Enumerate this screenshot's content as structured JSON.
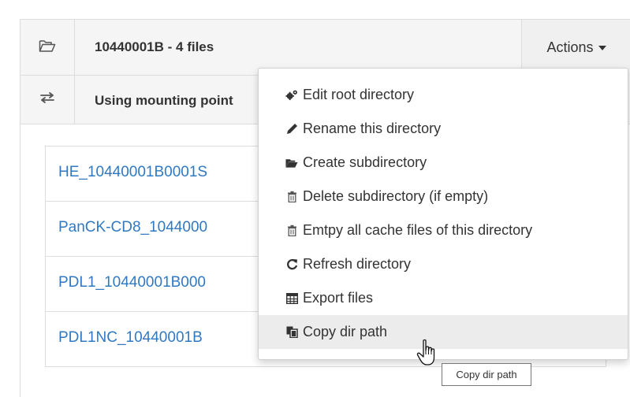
{
  "header": {
    "folder_title": "10440001B - 4 files",
    "mount_text": "Using mounting point",
    "actions_label": "Actions",
    "folder_icon": "folder-open-icon",
    "mount_icon": "exchange-icon"
  },
  "files": [
    {
      "name": "HE_10440001B0001S"
    },
    {
      "name": "PanCK-CD8_1044000"
    },
    {
      "name": "PDL1_10440001B000"
    },
    {
      "name": "PDL1NC_10440001B"
    }
  ],
  "menu": {
    "items": [
      {
        "label": "Edit root directory",
        "icon": "cogs-icon"
      },
      {
        "label": "Rename this directory",
        "icon": "pencil-icon"
      },
      {
        "label": "Create subdirectory",
        "icon": "folder-open-icon"
      },
      {
        "label": "Delete subdirectory (if empty)",
        "icon": "trash-icon"
      },
      {
        "label": "Emtpy all cache files of this directory",
        "icon": "trash-icon"
      },
      {
        "label": "Refresh directory",
        "icon": "refresh-icon"
      },
      {
        "label": "Export files",
        "icon": "table-icon"
      },
      {
        "label": "Copy dir path",
        "icon": "copy-icon"
      }
    ]
  },
  "tooltip": {
    "text": "Copy dir path"
  },
  "colors": {
    "link": "#3079c2",
    "hover": "#ececec",
    "panel_bg": "#f5f5f5"
  }
}
